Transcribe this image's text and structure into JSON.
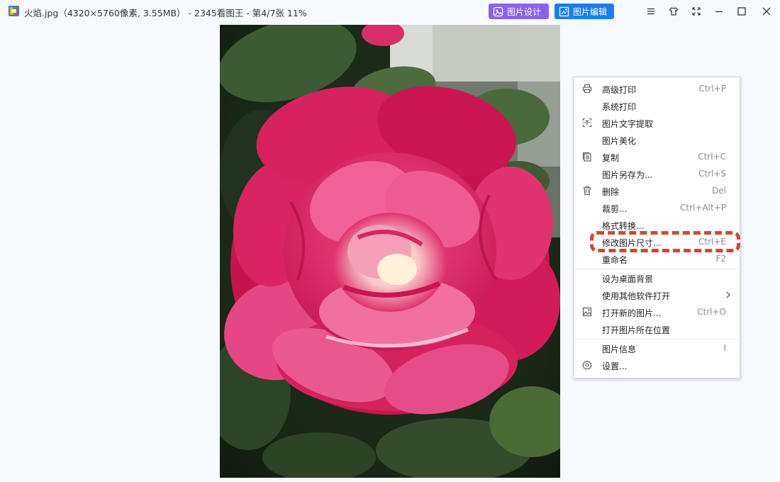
{
  "window": {
    "title": "火焰.jpg（4320×5760像素, 3.55MB） - 2345看图王 - 第4/7张 11%",
    "buttons": {
      "design_label": "图片设计",
      "edit_label": "图片编辑"
    },
    "controls": [
      "menu-icon",
      "skin-icon",
      "fullscreen-icon",
      "minimize-icon",
      "maximize-icon",
      "close-icon"
    ]
  },
  "image": {
    "subject": "pink rose photo"
  },
  "context_menu": {
    "items": [
      {
        "label": "高级打印",
        "shortcut": "Ctrl+P",
        "icon": "printer-icon"
      },
      {
        "label": "系统打印",
        "shortcut": "",
        "icon": ""
      },
      {
        "label": "图片文字提取",
        "shortcut": "",
        "icon": "text-extract-icon"
      },
      {
        "label": "图片美化",
        "shortcut": "",
        "icon": ""
      },
      {
        "label": "复制",
        "shortcut": "Ctrl+C",
        "icon": "copy-icon"
      },
      {
        "label": "图片另存为...",
        "shortcut": "Ctrl+S",
        "icon": ""
      },
      {
        "label": "删除",
        "shortcut": "Del",
        "icon": "trash-icon"
      },
      {
        "label": "裁剪...",
        "shortcut": "Ctrl+Alt+P",
        "icon": ""
      },
      {
        "label": "格式转换...",
        "shortcut": "",
        "icon": ""
      },
      {
        "label": "修改图片尺寸...",
        "shortcut": "Ctrl+E",
        "icon": ""
      },
      {
        "label": "重命名",
        "shortcut": "F2",
        "icon": ""
      },
      {
        "label": "设为桌面背景",
        "shortcut": "",
        "icon": ""
      },
      {
        "label": "使用其他软件打开",
        "shortcut": "",
        "icon": "",
        "submenu": true
      },
      {
        "label": "打开新的图片...",
        "shortcut": "Ctrl+O",
        "icon": "image-icon"
      },
      {
        "label": "打开图片所在位置",
        "shortcut": "",
        "icon": ""
      },
      {
        "label": "图片信息",
        "shortcut": "I",
        "icon": ""
      },
      {
        "label": "设置...",
        "shortcut": "",
        "icon": "gear-icon"
      }
    ],
    "highlighted_item": "修改图片尺寸...",
    "highlight_color": "#c94a3a"
  },
  "colors": {
    "design_button": "#8b63e8",
    "edit_button": "#1a7ef0",
    "background": "#f6fafe"
  }
}
